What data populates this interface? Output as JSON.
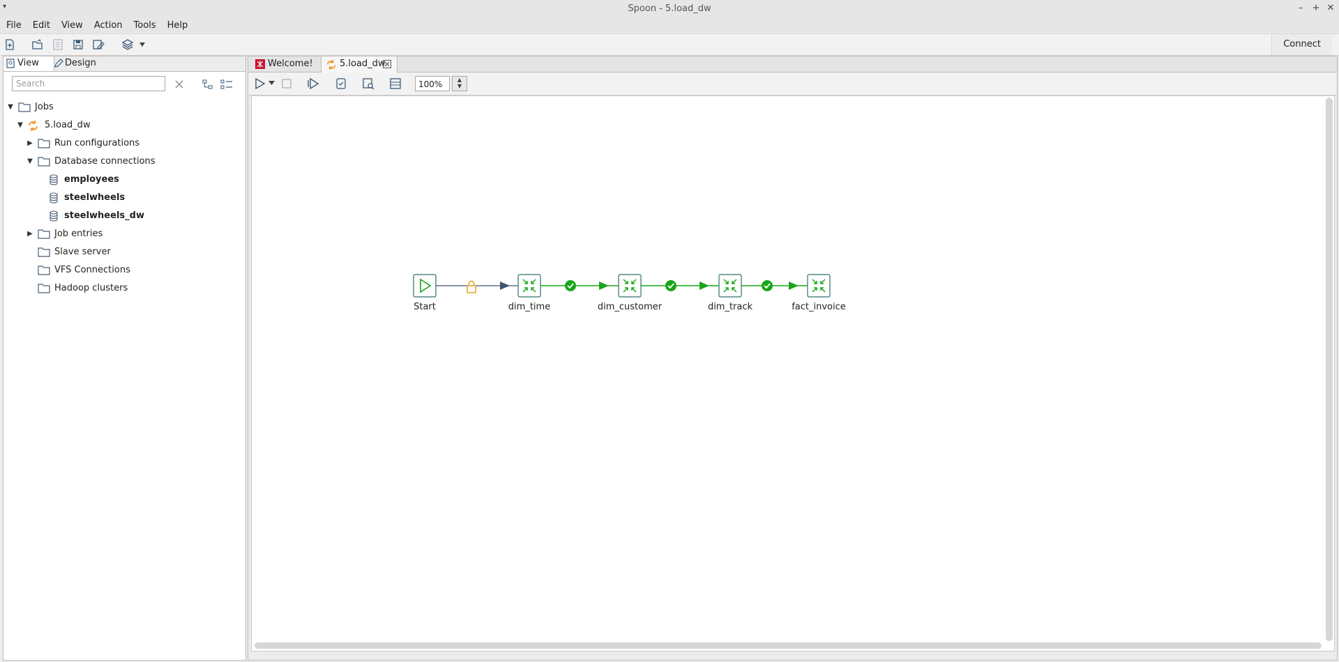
{
  "window": {
    "title": "Spoon - 5.load_dw"
  },
  "menu": [
    "File",
    "Edit",
    "View",
    "Action",
    "Tools",
    "Help"
  ],
  "toolbar": {
    "connect_label": "Connect"
  },
  "left_panel": {
    "tabs": {
      "view": "View",
      "design": "Design"
    },
    "search_placeholder": "Search",
    "tree": [
      {
        "label": "Jobs",
        "icon": "folder-icon",
        "state": "expanded"
      },
      {
        "label": "5.load_dw",
        "icon": "job-icon",
        "state": "expanded"
      },
      {
        "label": "Run configurations",
        "icon": "folder-icon",
        "state": "collapsed"
      },
      {
        "label": "Database connections",
        "icon": "folder-icon",
        "state": "expanded"
      },
      {
        "label": "employees",
        "icon": "database-icon",
        "bold": true
      },
      {
        "label": "steelwheels",
        "icon": "database-icon",
        "bold": true
      },
      {
        "label": "steelwheels_dw",
        "icon": "database-icon",
        "bold": true
      },
      {
        "label": "Job entries",
        "icon": "folder-icon",
        "state": "collapsed"
      },
      {
        "label": "Slave server",
        "icon": "folder-icon"
      },
      {
        "label": "VFS Connections",
        "icon": "folder-icon"
      },
      {
        "label": "Hadoop clusters",
        "icon": "folder-icon"
      }
    ]
  },
  "doc_tabs": {
    "welcome": "Welcome!",
    "job": "5.load_dw"
  },
  "job_toolbar": {
    "zoom": "100%"
  },
  "job_canvas": {
    "nodes": [
      "Start",
      "dim_time",
      "dim_customer",
      "dim_track",
      "fact_invoice"
    ],
    "hops": [
      {
        "from": "Start",
        "to": "dim_time",
        "type": "unconditional-lock"
      },
      {
        "from": "dim_time",
        "to": "dim_customer",
        "type": "success"
      },
      {
        "from": "dim_customer",
        "to": "dim_track",
        "type": "success"
      },
      {
        "from": "dim_track",
        "to": "fact_invoice",
        "type": "success"
      }
    ],
    "colors": {
      "success": "#1aa51a",
      "unconditional": "#3e566c",
      "lock": "#e8a020",
      "node_border": "#2f6f6f"
    }
  }
}
